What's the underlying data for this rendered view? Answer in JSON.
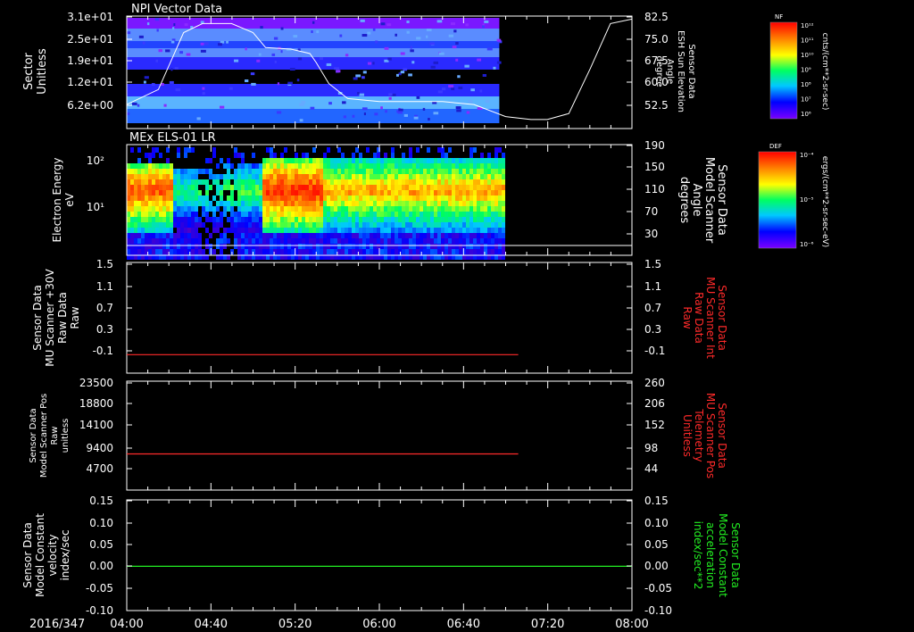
{
  "time_axis": {
    "date_label": "2016/347",
    "ticks": [
      "04:00",
      "04:40",
      "05:20",
      "06:00",
      "06:40",
      "07:20",
      "08:00"
    ]
  },
  "colorbars": {
    "top": {
      "title": "NF",
      "unit": "cnts/(cm**2-sr-sec)",
      "ticks": [
        "10¹²",
        "10¹¹",
        "10¹⁰",
        "10⁹",
        "10⁸",
        "10⁷",
        "10⁶"
      ]
    },
    "bottom": {
      "title": "DEF",
      "unit": "ergs/(cm**2-sr-sec-eV)",
      "ticks": [
        "10⁻⁴",
        "10⁻⁵",
        "10⁻⁶"
      ]
    }
  },
  "colors": {
    "red": "#ff2a2a",
    "green": "#22ee22",
    "white": "#ffffff"
  },
  "chart_data": [
    {
      "type": "heatmap",
      "title": "NPI Vector Data",
      "ylabel": [
        "Sector",
        "Unitless"
      ],
      "yticks": [
        "3.1e+01",
        "2.5e+01",
        "1.9e+01",
        "1.2e+01",
        "6.2e+00"
      ],
      "right_ylabel": [
        "Sensor Data",
        "ESH Sun Elevation",
        "Angle",
        "degree"
      ],
      "right_yticks": [
        "82.5",
        "75.0",
        "67.5",
        "60.0",
        "52.5"
      ],
      "right_ylim": [
        45,
        82.5
      ],
      "overlay_line": {
        "t": [
          4.0,
          4.25,
          4.45,
          4.6,
          4.83,
          5.0,
          5.1,
          5.3,
          5.45,
          5.5,
          5.6,
          5.75,
          6.0,
          6.5,
          6.75,
          7.0,
          7.2,
          7.33,
          7.5,
          7.67,
          7.83,
          8.0
        ],
        "values": [
          53,
          58,
          77,
          80,
          80,
          77,
          72,
          71.5,
          70,
          67,
          60,
          55,
          54,
          54,
          53,
          49,
          48,
          48,
          50,
          65,
          80,
          81.5
        ]
      },
      "data_end_time": "06:57"
    },
    {
      "type": "heatmap",
      "title": "MEx ELS-01 LR",
      "ylabel": [
        "Electron Energy",
        "eV"
      ],
      "yticks": [
        "10²",
        "10¹"
      ],
      "right_ylabel": [
        "Sensor Data",
        "Model Scanner",
        "Angle",
        "degrees"
      ],
      "right_yticks": [
        "190",
        "150",
        "110",
        "70",
        "30"
      ],
      "data_end_time": "06:59"
    },
    {
      "type": "line",
      "ylabel": [
        "Sensor Data",
        "MU Scanner +30V",
        "Raw Data",
        "Raw"
      ],
      "yticks": [
        "1.5",
        "1.1",
        "0.7",
        "0.3",
        "-0.1"
      ],
      "ylim": [
        -0.3,
        1.5
      ],
      "right_ylabel": [
        "Sensor Data",
        "MU Scanner Int",
        "Raw Data",
        "Raw"
      ],
      "right_yticks": [
        "1.5",
        "1.1",
        "0.7",
        "0.3",
        "-0.1"
      ],
      "series": [
        {
          "t": [
            4.0,
            7.1
          ],
          "values": [
            0.0,
            0.0
          ]
        }
      ]
    },
    {
      "type": "line",
      "ylabel": [
        "Sensor Data",
        "Model Scanner Pos",
        "Raw",
        "unitless"
      ],
      "yticks": [
        "23500",
        "18800",
        "14100",
        "9400",
        "4700"
      ],
      "ylim": [
        0,
        23500
      ],
      "right_ylabel": [
        "Sensor Data",
        "MU Scanner Pos",
        "Telemetry",
        "Unitless"
      ],
      "right_yticks": [
        "260",
        "206",
        "152",
        "98",
        "44"
      ],
      "series": [
        {
          "t": [
            4.0,
            7.1
          ],
          "values": [
            7800,
            7800
          ]
        }
      ]
    },
    {
      "type": "line",
      "ylabel": [
        "Sensor Data",
        "Model Constant",
        "velocity",
        "index/sec"
      ],
      "yticks": [
        "0.15",
        "0.10",
        "0.05",
        "0.00",
        "-0.05",
        "-0.10"
      ],
      "ylim": [
        -0.1,
        0.15
      ],
      "right_ylabel": [
        "Sensor Data",
        "Model Constant",
        "acceleration",
        "index/sec**2"
      ],
      "right_yticks": [
        "0.15",
        "0.10",
        "0.05",
        "0.00",
        "-0.05",
        "-0.10"
      ],
      "series": [
        {
          "t": [
            4.0,
            8.0
          ],
          "values": [
            0.0,
            0.0
          ]
        }
      ]
    }
  ]
}
